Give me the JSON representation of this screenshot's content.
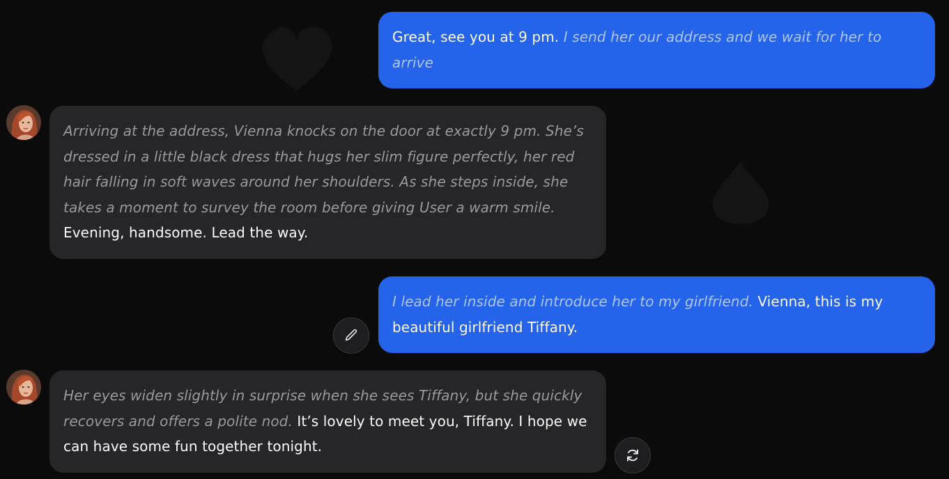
{
  "messages": [
    {
      "role": "user",
      "speech": "Great, see you at 9 pm. ",
      "action": "I send her our address and we wait for her to arrive"
    },
    {
      "role": "character",
      "action": "Arriving at the address, Vienna knocks on the door at exactly 9 pm. She’s dressed in a little black dress that hugs her slim figure perfectly, her red hair falling in soft waves around her shoulders. As she steps inside, she takes a moment to survey the room before giving User a warm smile.",
      "speech": " Evening, handsome. Lead the way."
    },
    {
      "role": "user",
      "action": "I lead her inside and introduce her to my girlfriend.",
      "speech": " Vienna, this is my beautiful girlfriend Tiffany."
    },
    {
      "role": "character",
      "action": "Her eyes widen slightly in surprise when she sees Tiffany, but she quickly recovers and offers a polite nod.",
      "speech": " It’s lovely to meet you, Tiffany. I hope we can have some fun together tonight."
    }
  ],
  "icons": {
    "edit": "pencil-icon",
    "regenerate": "refresh-icon",
    "avatar": "character-avatar"
  },
  "colors": {
    "background": "#0b0b0c",
    "user_bubble": "#2563eb",
    "bot_bubble": "#262628",
    "user_action_text": "#aec6f8",
    "bot_action_text": "#9a9a9e"
  }
}
